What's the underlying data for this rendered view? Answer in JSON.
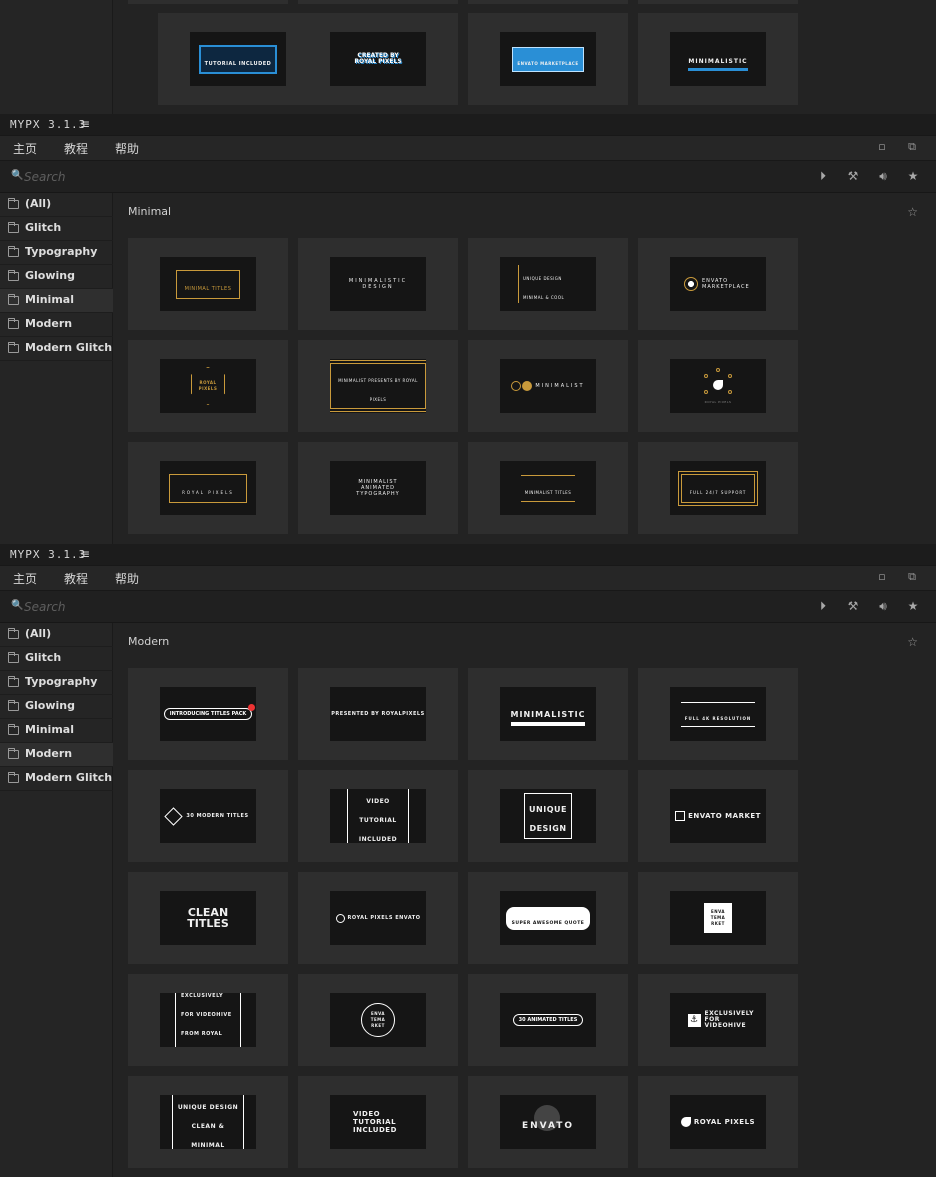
{
  "app": {
    "title": "MYPX 3.1.3",
    "menu_glyph": "≡"
  },
  "menu": {
    "home": "主页",
    "tutorial": "教程",
    "help": "帮助"
  },
  "search": {
    "placeholder": "Search"
  },
  "categories": [
    "(All)",
    "Glitch",
    "Typography",
    "Glowing",
    "Minimal",
    "Modern",
    "Modern Glitch"
  ],
  "top_partial": {
    "thumbs": [
      {
        "text": "TUTORIAL INCLUDED",
        "style": "blue-badge"
      },
      {
        "text": "CREATED BY ROYAL PIXELS",
        "style": "blue-stack"
      },
      {
        "text": "ENVATO MARKETPLACE",
        "style": "blue-bar"
      },
      {
        "text": "MINIMALISTIC",
        "style": "blue-underline"
      }
    ]
  },
  "panel_minimal": {
    "section_title": "Minimal",
    "active_category": "Minimal",
    "thumbs": [
      {
        "text": "MINIMAL TITLES"
      },
      {
        "text": "MINIMALISTIC DESIGN"
      },
      {
        "text": "UNIQUE DESIGN MINIMAL & COOL"
      },
      {
        "text": "ENVATO MARKETPLACE"
      },
      {
        "text": "ROYAL PIXELS"
      },
      {
        "text": "MINIMALIST PRESENTS BY ROYAL PIXELS"
      },
      {
        "text": "MINIMALIST"
      },
      {
        "text": "ROYAL PIXELS"
      },
      {
        "text": "ROYAL PIXELS"
      },
      {
        "text": "MINIMALIST ANIMATED TYPOGRAPHY"
      },
      {
        "text": "MINIMALIST TITLES"
      },
      {
        "text": "FULL 24/7 SUPPORT"
      }
    ]
  },
  "panel_modern": {
    "section_title": "Modern",
    "active_category": "Modern",
    "thumbs": [
      {
        "text": "INTRODUCING TITLES PACK"
      },
      {
        "text": "PRESENTED BY ROYALPIXELS"
      },
      {
        "text": "MINIMALISTIC"
      },
      {
        "text": "FULL 4K RESOLUTION"
      },
      {
        "text": "30 MODERN TITLES"
      },
      {
        "text": "VIDEO TUTORIAL INCLUDED"
      },
      {
        "text": "UNIQUE DESIGN"
      },
      {
        "text": "ENVATO MARKET"
      },
      {
        "text": "CLEAN TITLES"
      },
      {
        "text": "ROYAL PIXELS ENVATO"
      },
      {
        "text": "SUPER AWESOME QUOTE"
      },
      {
        "text": "ENVA TEMA RKET"
      },
      {
        "text": "EXCLUSIVELY FOR VIDEOHIVE FROM ROYAL PIXELS"
      },
      {
        "text": "ENVA TEMA RKET"
      },
      {
        "text": "30 ANIMATED TITLES"
      },
      {
        "text": "EXCLUSIVELY FOR VIDEOHIVE"
      },
      {
        "text": "UNIQUE DESIGN CLEAN & MINIMAL"
      },
      {
        "text": "VIDEO TUTORIAL INCLUDED"
      },
      {
        "text": "ENVATO"
      },
      {
        "text": "ROYAL PIXELS"
      }
    ]
  },
  "colors": {
    "background": "#232323",
    "gold": "#c99a3b",
    "blue": "#2a8fd6",
    "card": "#2e2e2e",
    "thumb": "#151515"
  },
  "icons": {
    "play": "play-circle-icon",
    "brush": "brush-icon",
    "volume": "volume-icon",
    "star": "star-icon"
  }
}
